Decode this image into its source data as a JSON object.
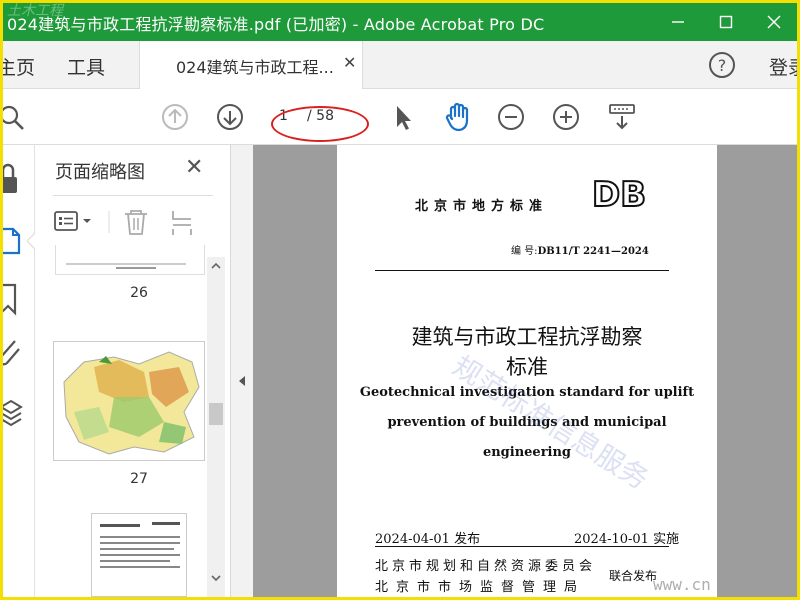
{
  "window": {
    "title": "024建筑与市政工程抗浮勘察标准.pdf  (已加密)  - Adobe Acrobat Pro DC",
    "watermark": "土木工程"
  },
  "tabs": {
    "home": "主页",
    "tools": "工具",
    "document": "024建筑与市政工程...",
    "login": "登录"
  },
  "toolbar": {
    "current_page": "1",
    "total_pages": "/ 58",
    "icons": [
      "search-icon",
      "page-up-icon",
      "page-down-icon",
      "select-cursor-icon",
      "hand-tool-icon",
      "zoom-out-icon",
      "zoom-in-icon",
      "keyboard-scroll-icon"
    ]
  },
  "panel": {
    "title": "页面缩略图",
    "thumbnails": [
      {
        "page": "26"
      },
      {
        "page": "27"
      }
    ]
  },
  "document": {
    "header_std": "北京市地方标准",
    "logo": "DB",
    "code_prefix": "编  号:",
    "code_value": "DB11/T 2241—2024",
    "title_cn_line1": "建筑与市政工程抗浮勘察",
    "title_cn_line2": "标准",
    "title_en_line1": "Geotechnical investigation standard for uplift",
    "title_en_line2": "prevention of buildings and municipal",
    "title_en_line3": "engineering",
    "issue_date": "2024-04-01 发布",
    "effective_date": "2024-10-01 实施",
    "issuer1": "北京市规划和自然资源委员会",
    "issuer2": "北京市市场监督管理局",
    "joint": "联合发布",
    "watermark_text": "规范标准信息服务",
    "watermark_url": "www.cn"
  },
  "colors": {
    "titlebar": "#1f9a3a",
    "frame": "#f4e000",
    "annotation": "#d92020",
    "accent": "#1a73c8"
  }
}
